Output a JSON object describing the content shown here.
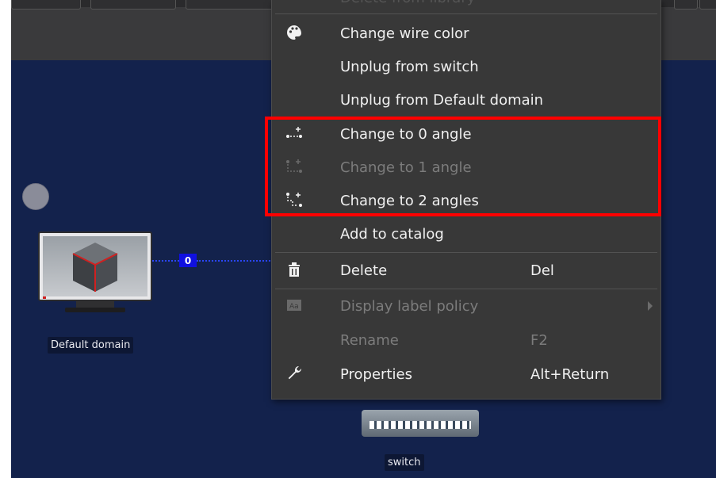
{
  "canvas": {
    "nodes": {
      "domain_label": "Default domain",
      "switch_label": "switch",
      "wire_badge": "0"
    }
  },
  "context_menu": {
    "partial_top_item": "Delete from library",
    "items": [
      {
        "label": "Change wire color",
        "shortcut": "",
        "icon": "palette-icon",
        "enabled": true
      },
      {
        "label": "Unplug from switch",
        "shortcut": "",
        "icon": "",
        "enabled": true
      },
      {
        "label": "Unplug from Default domain",
        "shortcut": "",
        "icon": "",
        "enabled": true
      },
      {
        "label": "Change to 0 angle",
        "shortcut": "",
        "icon": "zero-angle-icon",
        "enabled": true
      },
      {
        "label": "Change to 1 angle",
        "shortcut": "",
        "icon": "one-angle-icon",
        "enabled": false
      },
      {
        "label": "Change to 2 angles",
        "shortcut": "",
        "icon": "two-angles-icon",
        "enabled": true
      },
      {
        "label": "Add to catalog",
        "shortcut": "",
        "icon": "",
        "enabled": true
      },
      {
        "label": "Delete",
        "shortcut": "Del",
        "icon": "trash-icon",
        "enabled": true
      },
      {
        "label": "Display label policy",
        "shortcut": "",
        "icon": "label-icon",
        "enabled": false
      },
      {
        "label": "Rename",
        "shortcut": "F2",
        "icon": "",
        "enabled": false
      },
      {
        "label": "Properties",
        "shortcut": "Alt+Return",
        "icon": "wrench-icon",
        "enabled": true
      }
    ]
  },
  "colors": {
    "canvas_bg": "#13224c",
    "menu_bg": "#383838",
    "highlight": "#ff0000",
    "wire": "#2a46ff"
  }
}
